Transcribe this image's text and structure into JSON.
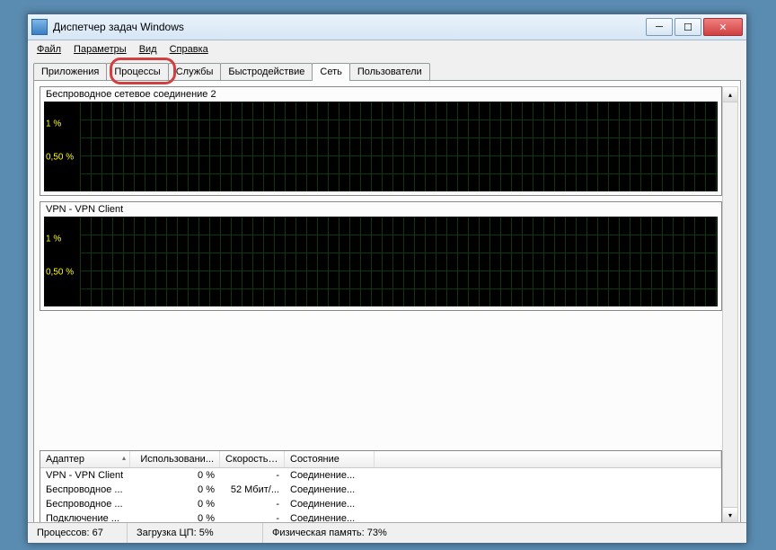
{
  "window": {
    "title": "Диспетчер задач Windows"
  },
  "menu": {
    "file": "Файл",
    "options": "Параметры",
    "view": "Вид",
    "help": "Справка"
  },
  "tabs": {
    "apps": "Приложения",
    "processes": "Процессы",
    "services": "Службы",
    "performance": "Быстродействие",
    "network": "Сеть",
    "users": "Пользователи"
  },
  "graphs": [
    {
      "title": "Беспроводное сетевое соединение 2",
      "labels": [
        "1 %",
        "0,50 %"
      ]
    },
    {
      "title": "VPN - VPN Client",
      "labels": [
        "1 %",
        "0,50 %"
      ]
    }
  ],
  "table": {
    "headers": {
      "adapter": "Адаптер",
      "usage": "Использовани...",
      "speed": "Скорость ...",
      "state": "Состояние"
    },
    "rows": [
      {
        "adapter": "VPN - VPN Client",
        "usage": "0 %",
        "speed": "-",
        "state": "Соединение..."
      },
      {
        "adapter": "Беспроводное ...",
        "usage": "0 %",
        "speed": "52 Мбит/...",
        "state": "Соединение..."
      },
      {
        "adapter": "Беспроводное ...",
        "usage": "0 %",
        "speed": "-",
        "state": "Соединение..."
      },
      {
        "adapter": "Подключение ...",
        "usage": "0 %",
        "speed": "-",
        "state": "Соединение..."
      }
    ]
  },
  "status": {
    "processes": "Процессов: 67",
    "cpu": "Загрузка ЦП: 5%",
    "memory": "Физическая память: 73%"
  }
}
